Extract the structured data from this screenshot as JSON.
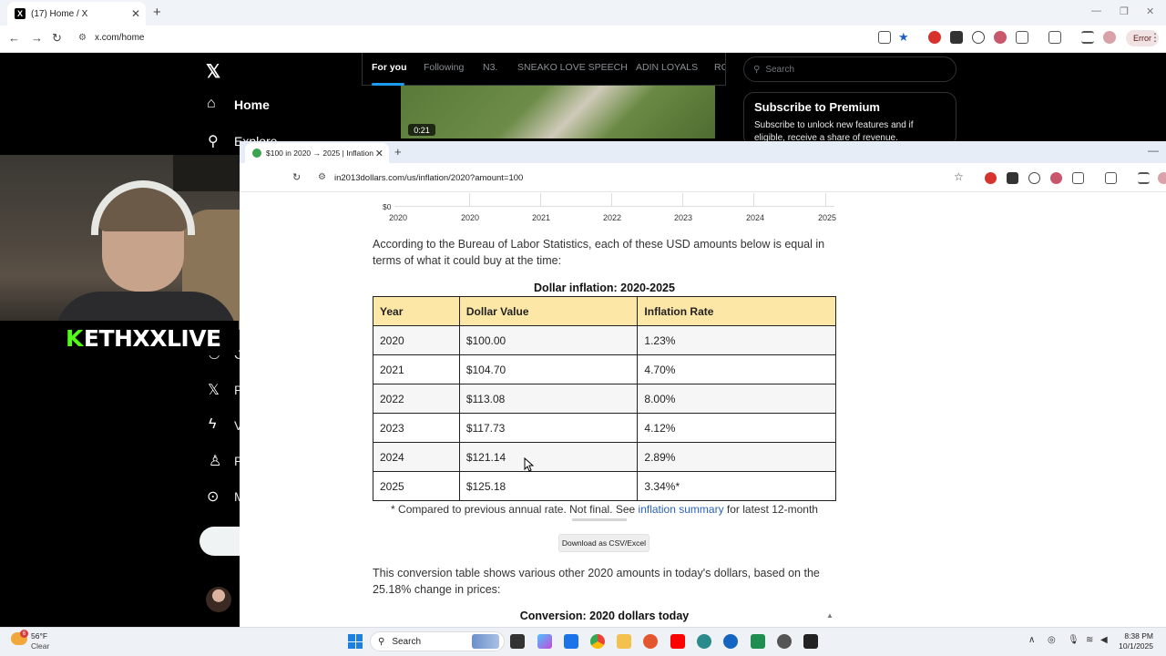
{
  "outer_browser": {
    "tab_title": "(17) Home / X",
    "url": "x.com/home",
    "error_label": "Error"
  },
  "x": {
    "nav": {
      "home": "Home",
      "explore": "Explore"
    },
    "tabs": [
      "For you",
      "Following",
      "N3.",
      "SNEAKO LOVE SPEECH",
      "ADIN LOYALS",
      "RO"
    ],
    "video_time": "0:21",
    "search_placeholder": "Search",
    "premium": {
      "title": "Subscribe to Premium",
      "body": "Subscribe to unlock new features and if eligible, receive a share of revenue."
    }
  },
  "stream_overlay": {
    "k": "K",
    "name": "ETHXXLIVE"
  },
  "inner_browser": {
    "tab_title": "$100 in 2020 → 2025 | Inflation",
    "url": "in2013dollars.com/us/inflation/2020?amount=100"
  },
  "page": {
    "axis_zero": "$0",
    "axis_years": [
      "2020",
      "2020",
      "2021",
      "2022",
      "2023",
      "2024",
      "2025"
    ],
    "intro": "According to the Bureau of Labor Statistics, each of these USD amounts below is equal in terms of what it could buy at the time:",
    "table_title": "Dollar inflation: 2020-2025",
    "table_headers": [
      "Year",
      "Dollar Value",
      "Inflation Rate"
    ],
    "rows": [
      [
        "2020",
        "$100.00",
        "1.23%"
      ],
      [
        "2021",
        "$104.70",
        "4.70%"
      ],
      [
        "2022",
        "$113.08",
        "8.00%"
      ],
      [
        "2023",
        "$117.73",
        "4.12%"
      ],
      [
        "2024",
        "$121.14",
        "2.89%"
      ],
      [
        "2025",
        "$125.18",
        "3.34%*"
      ]
    ],
    "footnote_pre": "* Compared to previous annual rate. Not final. See ",
    "footnote_link": "inflation summary",
    "footnote_post": " for latest 12-month",
    "csv_button": "Download as CSV/Excel",
    "conversion_text": "This conversion table shows various other 2020 amounts in today's dollars, based on the 25.18% change in prices:",
    "conversion_title": "Conversion: 2020 dollars today"
  },
  "taskbar": {
    "weather_temp": "56°F",
    "weather_cond": "Clear",
    "weather_badge": "6",
    "search": "Search",
    "time": "8:38 PM",
    "date": "10/1/2025"
  }
}
